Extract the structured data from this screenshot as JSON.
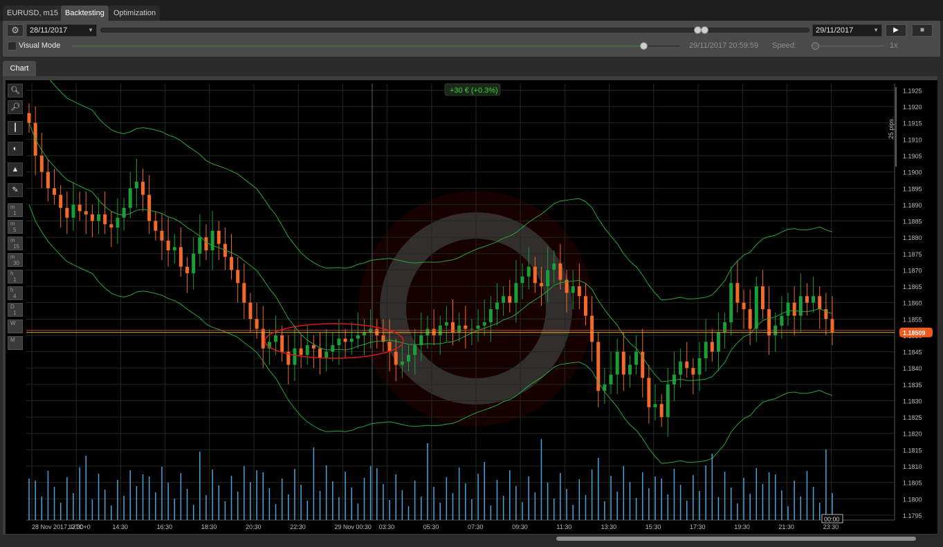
{
  "tabs": {
    "symbol": "EURUSD, m15",
    "backtesting": "Backtesting",
    "optimization": "Optimization"
  },
  "toolbar": {
    "gear_icon": "gear-icon",
    "start_date": "28/11/2017",
    "end_date": "29/11/2017",
    "play_icon": "▶",
    "stop_icon": "■",
    "visual_mode_label": "Visual Mode",
    "current_time": "29/11/2017 20:59:59",
    "speed_label": "Speed:",
    "speed_value": "1x"
  },
  "chart_tab": "Chart",
  "chart": {
    "profit_label": "+30 € (+0.3%)",
    "pips_label": "25 pips",
    "price_badge": "1.18509",
    "time_badge": "00:00",
    "timeframes": [
      {
        "top": "m",
        "bot": "1"
      },
      {
        "top": "m",
        "bot": "5"
      },
      {
        "top": "m",
        "bot": "15"
      },
      {
        "top": "m",
        "bot": "30"
      },
      {
        "top": "h",
        "bot": "1"
      },
      {
        "top": "h",
        "bot": "4"
      },
      {
        "top": "D",
        "bot": "1"
      },
      {
        "top": "W",
        "bot": ""
      },
      {
        "top": "M",
        "bot": ""
      }
    ],
    "colors": {
      "bull": "#1a9e3a",
      "bear": "#f46a2a",
      "band": "#2aa63a",
      "volume": "#4aa3e0",
      "badge": "#f05a1e"
    }
  },
  "chart_data": {
    "type": "candlestick",
    "symbol": "EURUSD",
    "timeframe": "m15",
    "y_ticks": [
      "1.1925",
      "1.1920",
      "1.1915",
      "1.1910",
      "1.1905",
      "1.1900",
      "1.1895",
      "1.1890",
      "1.1885",
      "1.1880",
      "1.1875",
      "1.1870",
      "1.1865",
      "1.1860",
      "1.1855",
      "1.1850",
      "1.1845",
      "1.1840",
      "1.1835",
      "1.1830",
      "1.1825",
      "1.1820",
      "1.1815",
      "1.1810",
      "1.1805",
      "1.1800",
      "1.1795"
    ],
    "x_ticks": [
      "28 Nov 2017, UTC+0",
      "12:30",
      "14:30",
      "16:30",
      "18:30",
      "20:30",
      "22:30",
      "29 Nov 00:30",
      "03:30",
      "05:30",
      "07:30",
      "09:30",
      "11:30",
      "13:30",
      "15:30",
      "17:30",
      "19:30",
      "21:30",
      "23:30"
    ],
    "ylim": [
      1.17935,
      1.1927
    ],
    "closes": [
      1.1915,
      1.1905,
      1.19,
      1.1895,
      1.1893,
      1.1889,
      1.1886,
      1.189,
      1.1888,
      1.1887,
      1.1885,
      1.1887,
      1.1884,
      1.1883,
      1.1886,
      1.1889,
      1.1895,
      1.1897,
      1.1893,
      1.1885,
      1.1882,
      1.1879,
      1.1876,
      1.1877,
      1.1871,
      1.1869,
      1.1875,
      1.188,
      1.1876,
      1.1882,
      1.1878,
      1.1874,
      1.187,
      1.1866,
      1.186,
      1.1855,
      1.1852,
      1.1846,
      1.1848,
      1.185,
      1.1845,
      1.1841,
      1.1846,
      1.1844,
      1.1847,
      1.1846,
      1.1843,
      1.1845,
      1.1847,
      1.1849,
      1.1848,
      1.1849,
      1.185,
      1.1851,
      1.1852,
      1.185,
      1.1848,
      1.1845,
      1.1841,
      1.1842,
      1.1844,
      1.1847,
      1.185,
      1.1852,
      1.185,
      1.1853,
      1.1854,
      1.1851,
      1.1853,
      1.1852,
      1.1852,
      1.1853,
      1.1854,
      1.1858,
      1.186,
      1.1862,
      1.186,
      1.1866,
      1.1868,
      1.1871,
      1.1866,
      1.1865,
      1.187,
      1.1872,
      1.1867,
      1.1863,
      1.1865,
      1.1862,
      1.1856,
      1.1848,
      1.1833,
      1.1835,
      1.1838,
      1.1845,
      1.1838,
      1.1841,
      1.1845,
      1.1837,
      1.1828,
      1.1829,
      1.1825,
      1.1835,
      1.1838,
      1.1842,
      1.184,
      1.1838,
      1.1843,
      1.1848,
      1.1845,
      1.1851,
      1.1854,
      1.1866,
      1.186,
      1.1858,
      1.1852,
      1.1865,
      1.1858,
      1.185,
      1.1853,
      1.1856,
      1.186,
      1.1856,
      1.1862,
      1.186,
      1.1862,
      1.1858,
      1.1855,
      1.1851
    ],
    "current_price": "1.18509"
  }
}
